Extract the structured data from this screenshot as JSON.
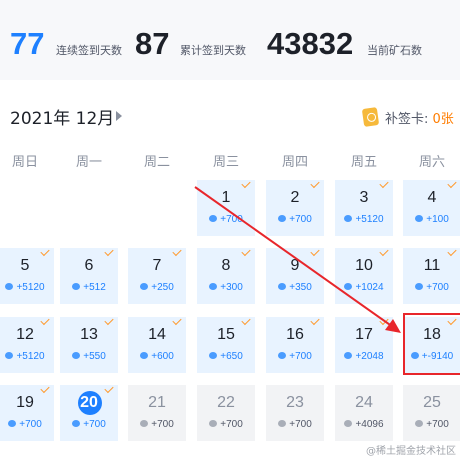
{
  "stats": {
    "streak": {
      "value": "77",
      "label": "连续签到天数"
    },
    "total": {
      "value": "87",
      "label": "累计签到天数"
    },
    "ore": {
      "value": "43832",
      "label": "当前矿石数"
    }
  },
  "calendar": {
    "month_label": "2021年 12月",
    "makeup_card": {
      "label": "补签卡:",
      "count": "0张"
    },
    "weekdays": [
      "周日",
      "周一",
      "周二",
      "周三",
      "周四",
      "周五",
      "周六"
    ],
    "days": [
      {
        "day": "1",
        "points": "+700",
        "status": "signed"
      },
      {
        "day": "2",
        "points": "+700",
        "status": "signed"
      },
      {
        "day": "3",
        "points": "+5120",
        "status": "signed"
      },
      {
        "day": "4",
        "points": "+100",
        "status": "signed"
      },
      {
        "day": "5",
        "points": "+5120",
        "status": "signed"
      },
      {
        "day": "6",
        "points": "+512",
        "status": "signed"
      },
      {
        "day": "7",
        "points": "+250",
        "status": "signed"
      },
      {
        "day": "8",
        "points": "+300",
        "status": "signed"
      },
      {
        "day": "9",
        "points": "+350",
        "status": "signed"
      },
      {
        "day": "10",
        "points": "+1024",
        "status": "signed"
      },
      {
        "day": "11",
        "points": "+700",
        "status": "signed"
      },
      {
        "day": "12",
        "points": "+5120",
        "status": "signed"
      },
      {
        "day": "13",
        "points": "+550",
        "status": "signed"
      },
      {
        "day": "14",
        "points": "+600",
        "status": "signed"
      },
      {
        "day": "15",
        "points": "+650",
        "status": "signed"
      },
      {
        "day": "16",
        "points": "+700",
        "status": "signed"
      },
      {
        "day": "17",
        "points": "+2048",
        "status": "signed"
      },
      {
        "day": "18",
        "points": "+-9140",
        "status": "signed"
      },
      {
        "day": "19",
        "points": "+700",
        "status": "signed"
      },
      {
        "day": "20",
        "points": "+700",
        "status": "today"
      },
      {
        "day": "21",
        "points": "+700",
        "status": "future"
      },
      {
        "day": "22",
        "points": "+700",
        "status": "future"
      },
      {
        "day": "23",
        "points": "+700",
        "status": "future"
      },
      {
        "day": "24",
        "points": "+4096",
        "status": "future"
      },
      {
        "day": "25",
        "points": "+700",
        "status": "future"
      }
    ]
  },
  "watermark": "@稀土掘金技术社区",
  "colors": {
    "accent": "#1e80ff",
    "highlight": "#e8262b",
    "check": "#ff9a2e",
    "signed_bg": "#e8f3ff",
    "future_bg": "#f2f3f5"
  },
  "icons": {
    "makeup_card": "makeup-card-icon",
    "gem": "ore-gem-icon",
    "check": "checkmark-icon",
    "next": "chevron-right-icon"
  }
}
